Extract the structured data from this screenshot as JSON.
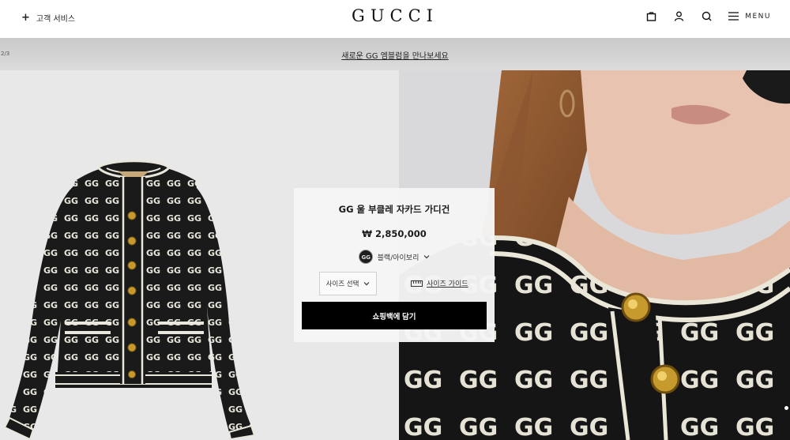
{
  "header": {
    "customer_service_label": "고객 서비스",
    "logo_text": "GUCCI",
    "menu_label": "MENU",
    "icons": [
      "shopping-bag-icon",
      "user-icon",
      "search-icon",
      "hamburger-menu-icon"
    ]
  },
  "announcement": {
    "counter": "2/3",
    "text": "새로운 GG 엠블럼을 만나보세요"
  },
  "product": {
    "name": "GG 울 부클레 자카드 가디건",
    "price": "₩ 2,850,000",
    "color_label": "블랙/아이보리",
    "size_select_label": "사이즈 선택",
    "size_guide_label": "사이즈 가이드",
    "add_to_bag_label": "쇼핑백에 담기"
  },
  "colors": {
    "card_bg": "#f5f5f5",
    "button_bg": "#000000",
    "left_bg": "#e8e8e8"
  }
}
